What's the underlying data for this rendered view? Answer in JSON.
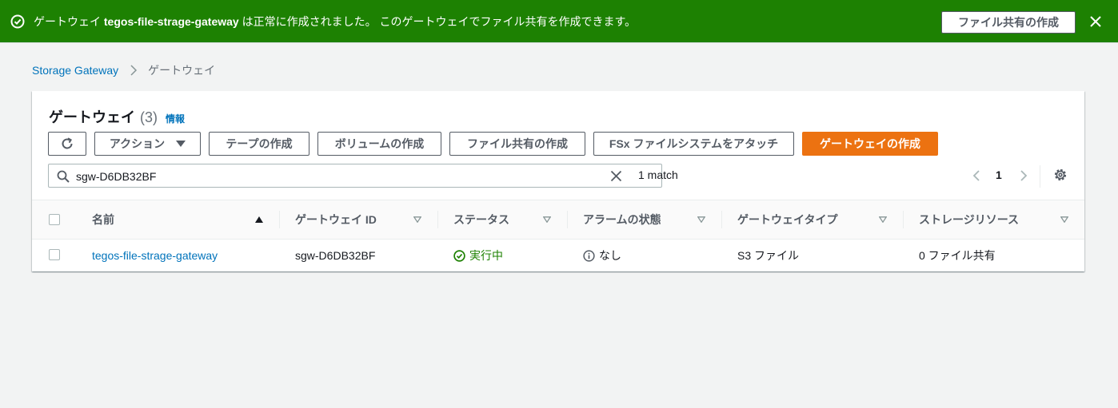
{
  "flash": {
    "message_prefix": "ゲートウェイ ",
    "gateway_name": "tegos-file-strage-gateway",
    "message_suffix": " は正常に作成されました。 このゲートウェイでファイル共有を作成できます。",
    "action_label": "ファイル共有の作成",
    "color": "#1d8102"
  },
  "breadcrumb": {
    "root": "Storage Gateway",
    "current": "ゲートウェイ"
  },
  "panel": {
    "title": "ゲートウェイ",
    "count": "(3)",
    "info": "情報"
  },
  "toolbar": {
    "refresh_icon": "refresh-icon",
    "actions_label": "アクション",
    "create_tape_label": "テープの作成",
    "create_volume_label": "ボリュームの作成",
    "create_fileshare_label": "ファイル共有の作成",
    "attach_fsx_label": "FSx ファイルシステムをアタッチ",
    "create_gateway_label": "ゲートウェイの作成",
    "primary_color": "#ec7211"
  },
  "search": {
    "value": "sgw-D6DB32BF",
    "match_text": "1 match"
  },
  "pagination": {
    "current_page": "1"
  },
  "table": {
    "columns": [
      "名前",
      "ゲートウェイ ID",
      "ステータス",
      "アラームの状態",
      "ゲートウェイタイプ",
      "ストレージリソース"
    ],
    "sorted_column": "名前",
    "rows": [
      {
        "name": "tegos-file-strage-gateway",
        "gateway_id": "sgw-D6DB32BF",
        "status": "実行中",
        "alarm_state": "なし",
        "gateway_type": "S3 ファイル",
        "storage_resources": "0 ファイル共有"
      }
    ]
  }
}
